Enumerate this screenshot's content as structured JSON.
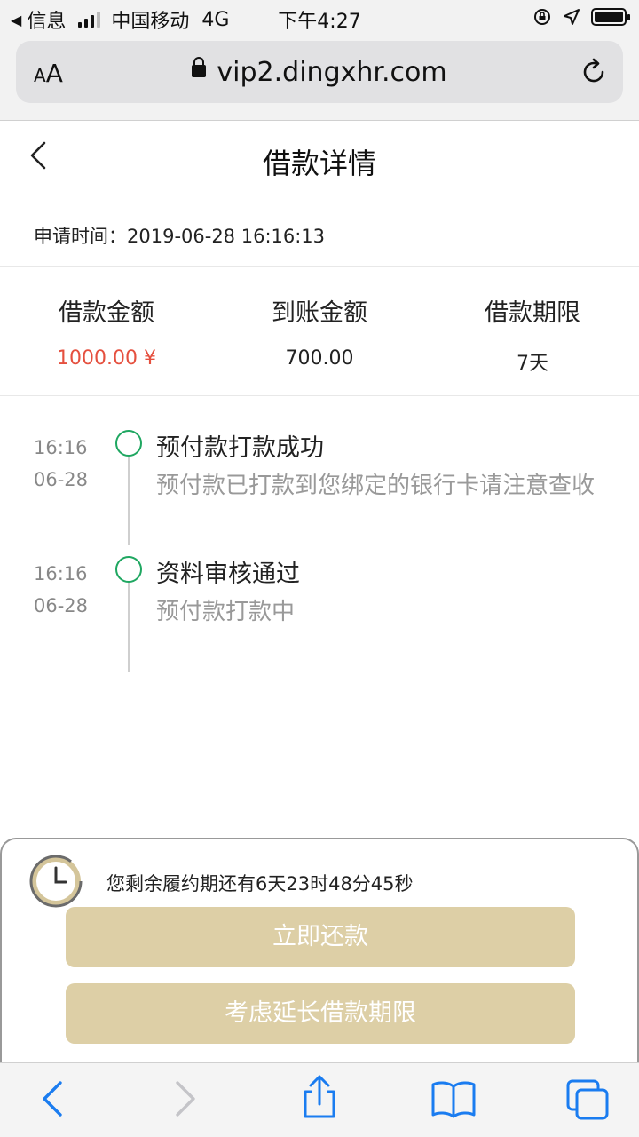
{
  "status_bar": {
    "back_label": "信息",
    "carrier": "中国移动",
    "network": "4G",
    "time": "下午4:27"
  },
  "browser": {
    "text_size_label_small": "A",
    "text_size_label_large": "A",
    "url": "vip2.dingxhr.com"
  },
  "page": {
    "title": "借款详情",
    "apply_time_label": "申请时间：",
    "apply_time_value": "2019-06-28 16:16:13"
  },
  "summary": [
    {
      "label": "借款金额",
      "value": "1000.00 ¥",
      "highlight": true
    },
    {
      "label": "到账金额",
      "value": "700.00",
      "highlight": false
    },
    {
      "label": "借款期限",
      "value": "7天",
      "highlight": false
    }
  ],
  "timeline": [
    {
      "time": "16:16",
      "date": "06-28",
      "title": "预付款打款成功",
      "desc": "预付款已打款到您绑定的银行卡请注意查收"
    },
    {
      "time": "16:16",
      "date": "06-28",
      "title": "资料审核通过",
      "desc": "预付款打款中"
    }
  ],
  "bottom_panel": {
    "countdown_text": "您剩余履约期还有6天23时48分45秒",
    "repay_button": "立即还款",
    "extend_button": "考虑延长借款期限"
  },
  "colors": {
    "accent_red": "#e5503f",
    "timeline_green": "#1fa761",
    "button_gold": "#ddcfa6",
    "ios_blue": "#1a7cf0"
  }
}
